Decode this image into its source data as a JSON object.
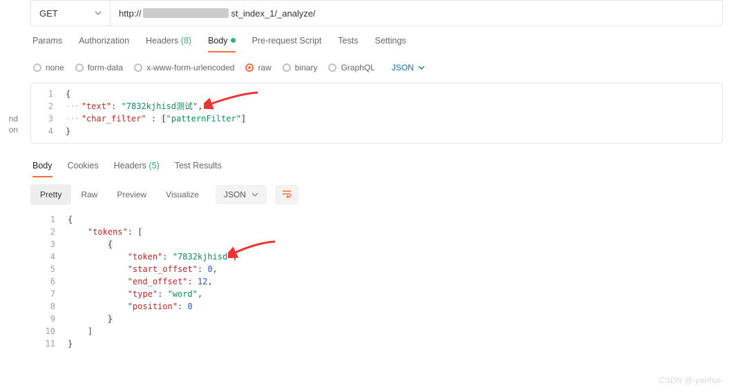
{
  "colors": {
    "accent": "#ff6c37",
    "link": "#0273cf",
    "success": "#2bb673"
  },
  "left_fragment": {
    "l1": "nd",
    "l2": "on"
  },
  "request": {
    "method": "GET",
    "url_prefix": "http://",
    "url_suffix": "st_index_1/_analyze/"
  },
  "tabs": {
    "params": "Params",
    "authorization": "Authorization",
    "headers": "Headers",
    "headers_count": "(8)",
    "body": "Body",
    "pre_request": "Pre-request Script",
    "tests": "Tests",
    "settings": "Settings"
  },
  "body_types": {
    "none": "none",
    "form_data": "form-data",
    "x_www": "x-www-form-urlencoded",
    "raw": "raw",
    "binary": "binary",
    "graphql": "GraphQL",
    "json": "JSON"
  },
  "req_body": {
    "l1": "{",
    "l2_key": "\"text\"",
    "l2_sep": ": ",
    "l2_val": "\"7832kjhisd测试\"",
    "l2_tail": ",",
    "l3_key": "\"char_filter\"",
    "l3_sep": " : ",
    "l3_b1": "[",
    "l3_val": "\"patternFilter\"",
    "l3_b2": "]",
    "l4": "}"
  },
  "resp_tabs": {
    "body": "Body",
    "cookies": "Cookies",
    "headers": "Headers",
    "headers_count": "(5)",
    "test_results": "Test Results"
  },
  "view_bar": {
    "pretty": "Pretty",
    "raw": "Raw",
    "preview": "Preview",
    "visualize": "Visualize",
    "json": "JSON"
  },
  "resp_body": {
    "l1": "{",
    "l2_k": "\"tokens\"",
    "l2_v": ": [",
    "l3": "{",
    "l4_k": "\"token\"",
    "l4_v": "\"7832kjhisd\"",
    "l5_k": "\"start_offset\"",
    "l5_v": "0",
    "l6_k": "\"end_offset\"",
    "l6_v": "12",
    "l7_k": "\"type\"",
    "l7_v": "\"word\"",
    "l8_k": "\"position\"",
    "l8_v": "0",
    "l9": "}",
    "l10": "]",
    "l11": "}",
    "sep": ": ",
    "comma": ","
  },
  "watermark": "CSDN @-yanhui-"
}
